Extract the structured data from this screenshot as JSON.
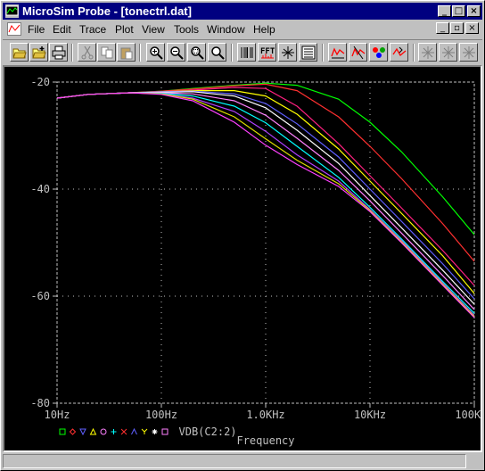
{
  "window": {
    "title": "MicroSim Probe - [tonectrl.dat]"
  },
  "menu": {
    "items": [
      "File",
      "Edit",
      "Trace",
      "Plot",
      "View",
      "Tools",
      "Window",
      "Help"
    ]
  },
  "toolbar": {
    "buttons": [
      "open-icon",
      "open-append-icon",
      "print-icon",
      "cut-icon",
      "copy-icon",
      "paste-icon",
      "zoom-in-icon",
      "zoom-out-icon",
      "zoom-area-icon",
      "zoom-fit-icon",
      "log-x-icon",
      "fourier-icon",
      "performance-analysis-icon",
      "eval-goal-icon",
      "add-trace-icon",
      "toggle-cursor-icon",
      "mark-label-icon",
      "cursor-peak-icon",
      "cursor-trough-icon",
      "cursor-slope-icon"
    ]
  },
  "chart_data": {
    "type": "line",
    "xlabel": "Frequency",
    "xscale": "log",
    "xlim": [
      10,
      100000
    ],
    "ylim": [
      -80,
      -20
    ],
    "grid": true,
    "x_ticks": [
      "10Hz",
      "100Hz",
      "1.0KHz",
      "10KHz",
      "100KHz"
    ],
    "y_ticks": [
      "-20",
      "-40",
      "-60",
      "-80"
    ],
    "legend_label": "VDB(C2:2)",
    "legend_markers": [
      "square",
      "diamond",
      "down-triangle",
      "up-triangle",
      "circle",
      "plus",
      "cross",
      "lambda",
      "y",
      "asterisk",
      "square"
    ],
    "x": [
      10,
      20,
      50,
      100,
      200,
      500,
      1000,
      2000,
      5000,
      10000,
      20000,
      50000,
      100000
    ],
    "series": [
      {
        "color": "#00ff00",
        "values": [
          -23.0,
          -22.3,
          -22.0,
          -21.7,
          -21.2,
          -20.6,
          -20.2,
          -20.6,
          -23.2,
          -27.5,
          -33.0,
          -41.5,
          -48.5
        ]
      },
      {
        "color": "#ff3030",
        "values": [
          -23.0,
          -22.3,
          -22.0,
          -21.7,
          -21.3,
          -20.7,
          -20.4,
          -21.6,
          -26.5,
          -32.0,
          -38.0,
          -46.5,
          -53.5
        ]
      },
      {
        "color": "#ff2080",
        "values": [
          -23.0,
          -22.3,
          -22.0,
          -21.8,
          -21.5,
          -21.0,
          -21.2,
          -24.5,
          -31.5,
          -37.5,
          -43.5,
          -51.5,
          -58.0
        ]
      },
      {
        "color": "#ffff00",
        "values": [
          -23.0,
          -22.3,
          -22.0,
          -21.8,
          -21.6,
          -21.6,
          -22.6,
          -26.0,
          -32.5,
          -38.5,
          -44.5,
          -52.5,
          -59.5
        ]
      },
      {
        "color": "#6060ff",
        "values": [
          -23.0,
          -22.3,
          -22.0,
          -21.8,
          -21.7,
          -22.2,
          -24.0,
          -27.8,
          -34.0,
          -40.0,
          -46.0,
          -54.0,
          -60.5
        ]
      },
      {
        "color": "#ffffff",
        "values": [
          -23.0,
          -22.3,
          -22.0,
          -21.9,
          -21.8,
          -22.6,
          -24.8,
          -29.0,
          -35.2,
          -41.2,
          -47.2,
          -55.2,
          -61.5
        ]
      },
      {
        "color": "#ff80ff",
        "values": [
          -23.0,
          -22.3,
          -22.0,
          -22.0,
          -22.2,
          -23.5,
          -26.2,
          -30.5,
          -36.5,
          -42.2,
          -48.2,
          -56.2,
          -62.5
        ]
      },
      {
        "color": "#00ffff",
        "values": [
          -23.0,
          -22.3,
          -22.0,
          -22.1,
          -22.6,
          -24.5,
          -27.6,
          -32.0,
          -37.8,
          -43.4,
          -49.3,
          -57.3,
          -63.2
        ]
      },
      {
        "color": "#b040ff",
        "values": [
          -23.0,
          -22.3,
          -22.0,
          -22.2,
          -23.0,
          -25.5,
          -29.2,
          -33.6,
          -38.5,
          -43.8,
          -49.6,
          -57.6,
          -63.6
        ]
      },
      {
        "color": "#dddd00",
        "values": [
          -23.0,
          -22.3,
          -22.0,
          -22.2,
          -23.2,
          -26.5,
          -30.6,
          -34.6,
          -39.0,
          -44.0,
          -49.8,
          -57.8,
          -63.8
        ]
      },
      {
        "color": "#ff40ff",
        "values": [
          -23.0,
          -22.3,
          -22.0,
          -22.3,
          -23.5,
          -27.5,
          -31.8,
          -35.4,
          -39.5,
          -44.2,
          -50.0,
          -58.0,
          -64.0
        ]
      }
    ]
  }
}
